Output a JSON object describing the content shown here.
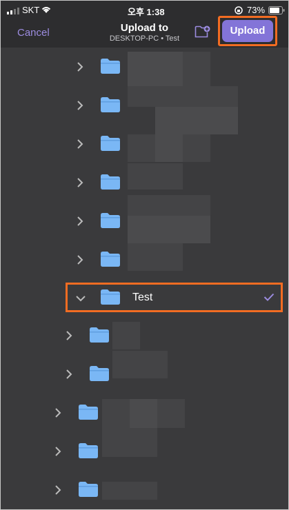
{
  "status": {
    "carrier": "SKT",
    "time": "오후 1:38",
    "battery": "73%"
  },
  "nav": {
    "cancel": "Cancel",
    "title": "Upload to",
    "subtitle": "DESKTOP-PC • Test",
    "upload": "Upload"
  },
  "tree": {
    "selected_label": "Test"
  },
  "colors": {
    "accent": "#8374d8",
    "highlight": "#f26c22",
    "folder": "#7ab7f5",
    "background": "#3a3a3c"
  }
}
